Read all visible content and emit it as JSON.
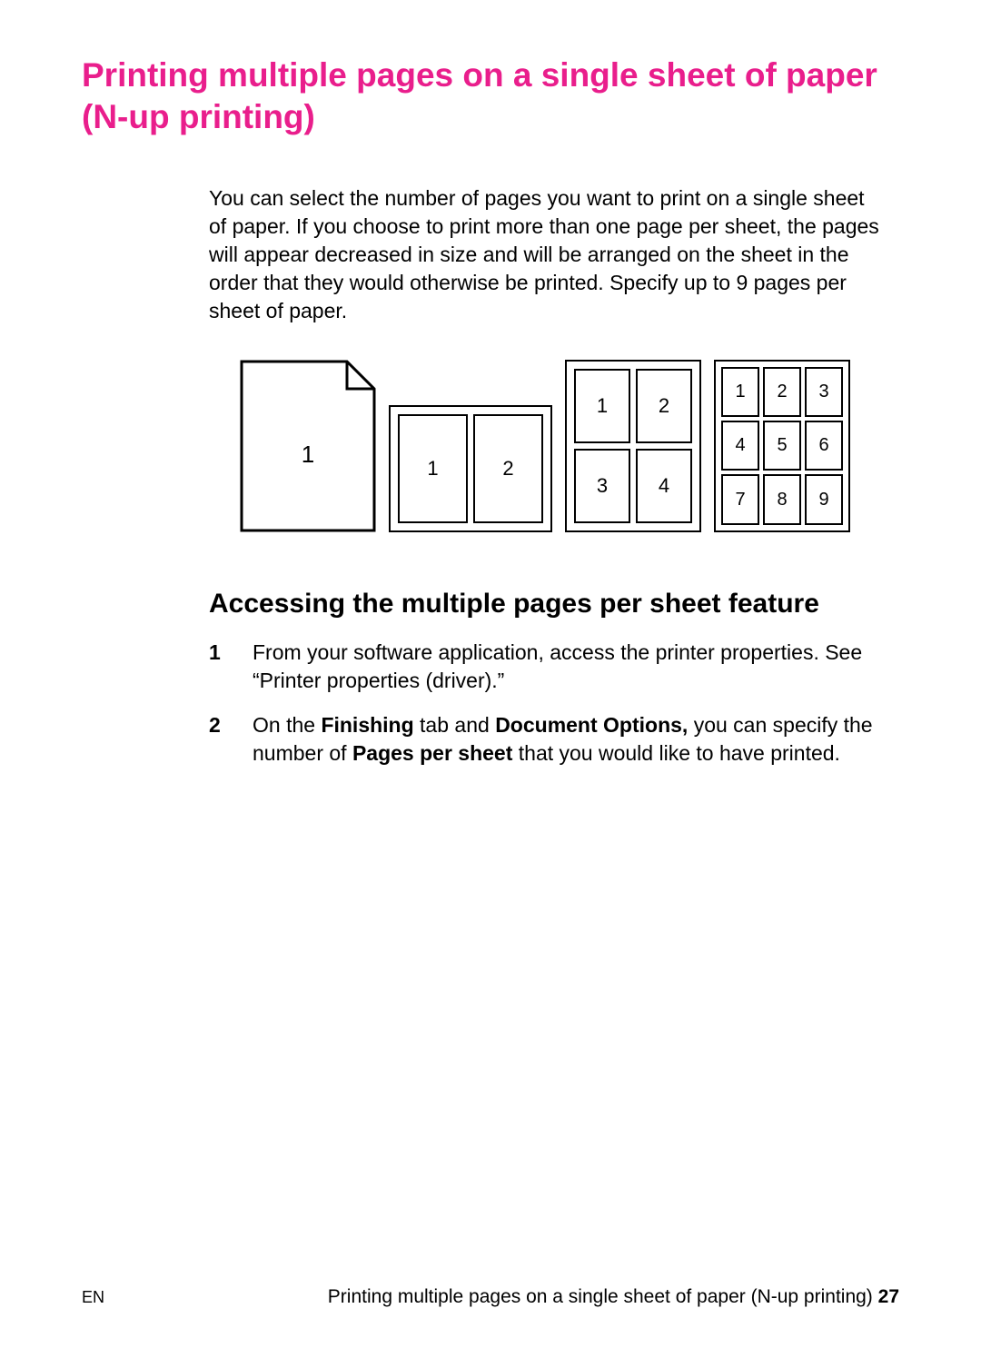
{
  "title": "Printing multiple pages on a single sheet of paper (N-up printing)",
  "intro": "You can select the number of pages you want to print on a single sheet of paper. If you choose to print more than one page per sheet, the pages will appear decreased in size and will be arranged on the sheet in the order that they would otherwise be printed. Specify up to 9 pages per sheet of paper.",
  "diagram": {
    "sheets": [
      {
        "cells": [
          "1"
        ]
      },
      {
        "cells": [
          "1",
          "2"
        ]
      },
      {
        "cells": [
          "1",
          "2",
          "3",
          "4"
        ]
      },
      {
        "cells": [
          "1",
          "2",
          "3",
          "4",
          "5",
          "6",
          "7",
          "8",
          "9"
        ]
      }
    ]
  },
  "subhead": "Accessing the multiple pages per sheet feature",
  "steps": [
    {
      "num": "1",
      "plain": "From your software application, access the printer properties. See “Printer properties (driver).”"
    },
    {
      "num": "2",
      "parts": {
        "p1": "On the ",
        "b1": "Finishing",
        "p2": " tab and ",
        "b2": "Document Options,",
        "p3": " you can specify the number of ",
        "b3": "Pages per sheet",
        "p4": " that you would like to have printed."
      }
    }
  ],
  "footer": {
    "lang": "EN",
    "caption": "Printing multiple pages on a single sheet of paper (N-up printing) ",
    "pagenum": "27"
  }
}
